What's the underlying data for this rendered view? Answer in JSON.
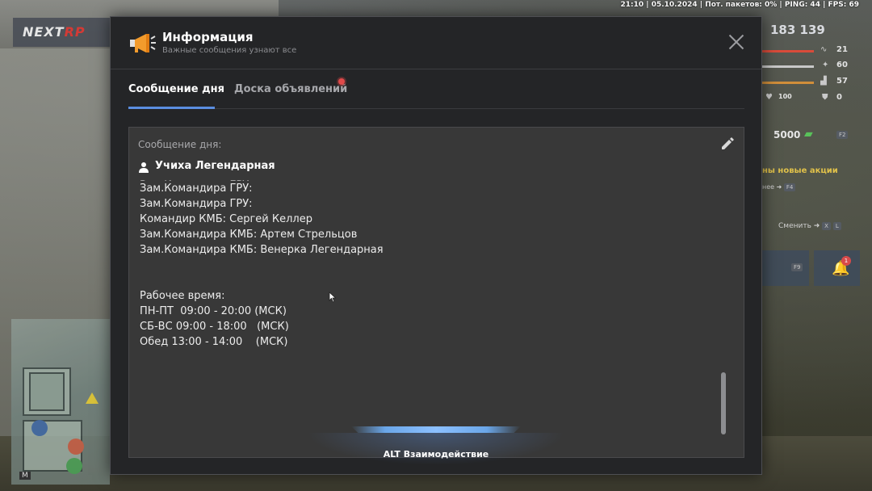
{
  "status_bar": {
    "text": "21:10 | 05.10.2024 | Пот. пакетов: 0% | PING: 44 | FPS: 69"
  },
  "game_logo": {
    "prefix": "NEXT",
    "suffix": "RP"
  },
  "hud": {
    "money": "183 139",
    "stats": [
      {
        "icon": "heartbeat-icon",
        "value": "21"
      },
      {
        "icon": "hunger-icon",
        "value": "60"
      },
      {
        "icon": "armor-icon",
        "value": "57"
      },
      {
        "icon": "shield-icon",
        "value": "0"
      }
    ],
    "health_value": "100",
    "cash": "5000",
    "cash_key": "F2",
    "promo_title": "ны новые акции",
    "promo_sub": "нее",
    "promo_key": "F4",
    "change_label": "Сменить",
    "change_keys": [
      "X",
      "L"
    ],
    "f9_key": "F9",
    "notif_badge": "1"
  },
  "minimap": {
    "label": "M"
  },
  "modal": {
    "title": "Информация",
    "subtitle": "Важные сообщения узнают все",
    "icon": "megaphone-icon",
    "tabs": [
      {
        "label": "Сообщение дня",
        "active": true
      },
      {
        "label": "Доска объявлений",
        "active": false,
        "has_notification": true
      }
    ],
    "content_label": "Сообщение дня:",
    "author": "Учиха Легендарная",
    "message_lines": [
      "Зам.Командира ГРУ:",
      "Зам.Командира ГРУ:",
      "Командир КМБ: Сергей Келлер",
      "Зам.Командира КМБ: Артем Стрельцов",
      "Зам.Командира КМБ: Венерка Легендарная",
      "",
      "",
      "Рабочее время:",
      "ПН-ПТ  09:00 - 20:00 (МСК)",
      "СБ-ВС 09:00 - 18:00   (МСК)",
      "Обед 13:00 - 14:00    (МСК)"
    ]
  },
  "interaction_hint": "ALT Взаимодействие",
  "colors": {
    "accent": "#5b8ee0",
    "modal_bg": "#242527",
    "content_bg": "#383838",
    "notification": "#e04a4a"
  }
}
